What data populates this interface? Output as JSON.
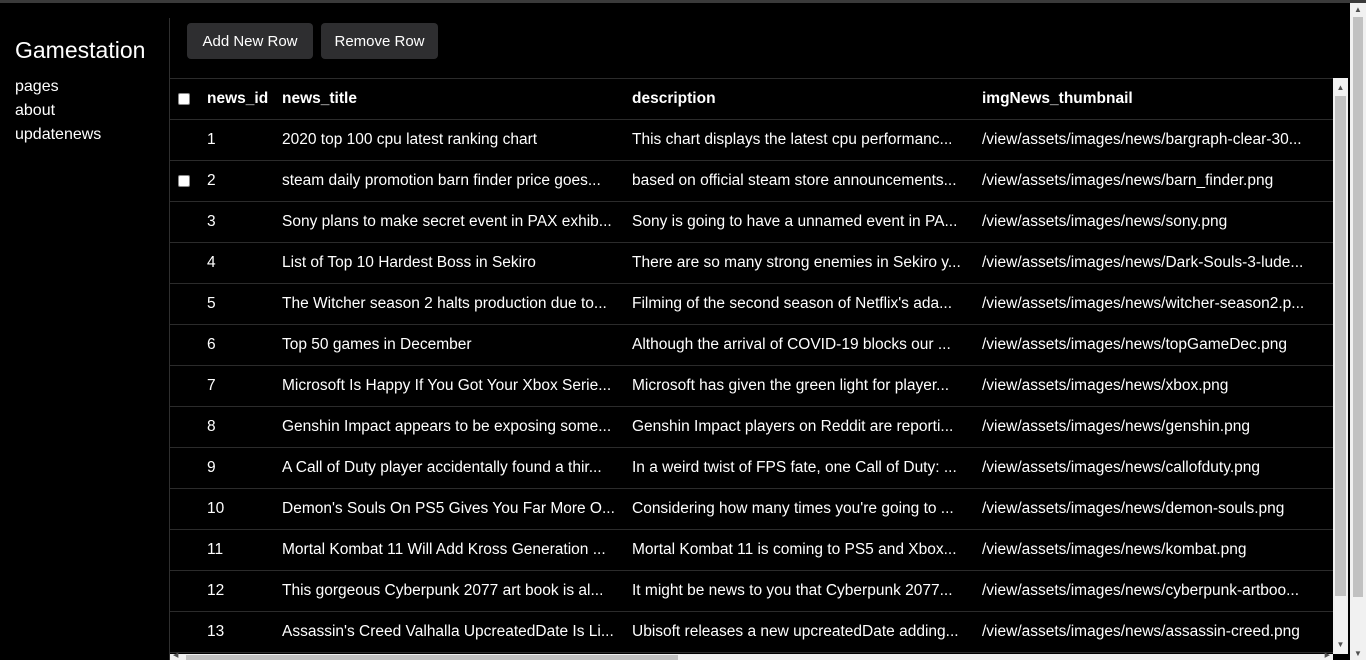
{
  "sidebar": {
    "brand": "Gamestation",
    "items": [
      {
        "label": "pages"
      },
      {
        "label": "about"
      },
      {
        "label": "updatenews"
      }
    ]
  },
  "toolbar": {
    "add_label": "Add New Row",
    "remove_label": "Remove Row"
  },
  "table": {
    "columns": [
      "news_id",
      "news_title",
      "description",
      "imgNews_thumbnail"
    ],
    "rows": [
      {
        "id": "1",
        "title": "2020 top 100 cpu latest ranking chart",
        "desc": "This chart displays the latest cpu performanc...",
        "img": "/view/assets/images/news/bargraph-clear-30...",
        "checkbox": false
      },
      {
        "id": "2",
        "title": "steam daily promotion barn finder price goes...",
        "desc": "based on official steam store announcements...",
        "img": "/view/assets/images/news/barn_finder.png",
        "checkbox": true
      },
      {
        "id": "3",
        "title": "Sony plans to make secret event in PAX exhib...",
        "desc": "Sony is going to have a unnamed event in PA...",
        "img": "/view/assets/images/news/sony.png",
        "checkbox": false
      },
      {
        "id": "4",
        "title": "List of Top 10 Hardest Boss in Sekiro",
        "desc": "There are so many strong enemies in Sekiro y...",
        "img": "/view/assets/images/news/Dark-Souls-3-lude...",
        "checkbox": false
      },
      {
        "id": "5",
        "title": "The Witcher season 2 halts production due to...",
        "desc": "Filming of the second season of Netflix's ada...",
        "img": "/view/assets/images/news/witcher-season2.p...",
        "checkbox": false
      },
      {
        "id": "6",
        "title": "Top 50 games in December",
        "desc": "Although the arrival of COVID-19 blocks our ...",
        "img": "/view/assets/images/news/topGameDec.png",
        "checkbox": false
      },
      {
        "id": "7",
        "title": "Microsoft Is Happy If You Got Your Xbox Serie...",
        "desc": "Microsoft has given the green light for player...",
        "img": "/view/assets/images/news/xbox.png",
        "checkbox": false
      },
      {
        "id": "8",
        "title": "Genshin Impact appears to be exposing some...",
        "desc": "Genshin Impact players on Reddit are reporti...",
        "img": "/view/assets/images/news/genshin.png",
        "checkbox": false
      },
      {
        "id": "9",
        "title": "A Call of Duty player accidentally found a thir...",
        "desc": "In a weird twist of FPS fate, one Call of Duty: ...",
        "img": "/view/assets/images/news/callofduty.png",
        "checkbox": false
      },
      {
        "id": "10",
        "title": "Demon's Souls On PS5 Gives You Far More O...",
        "desc": "Considering how many times you're going to ...",
        "img": "/view/assets/images/news/demon-souls.png",
        "checkbox": false
      },
      {
        "id": "11",
        "title": "Mortal Kombat 11 Will Add Kross Generation ...",
        "desc": "Mortal Kombat 11 is coming to PS5 and Xbox...",
        "img": "/view/assets/images/news/kombat.png",
        "checkbox": false
      },
      {
        "id": "12",
        "title": "This gorgeous Cyberpunk 2077 art book is al...",
        "desc": "It might be news to you that Cyberpunk 2077...",
        "img": "/view/assets/images/news/cyberpunk-artboo...",
        "checkbox": false
      },
      {
        "id": "13",
        "title": "Assassin's Creed Valhalla UpcreatedDate Is Li...",
        "desc": "Ubisoft releases a new upcreatedDate adding...",
        "img": "/view/assets/images/news/assassin-creed.png",
        "checkbox": false
      }
    ]
  }
}
